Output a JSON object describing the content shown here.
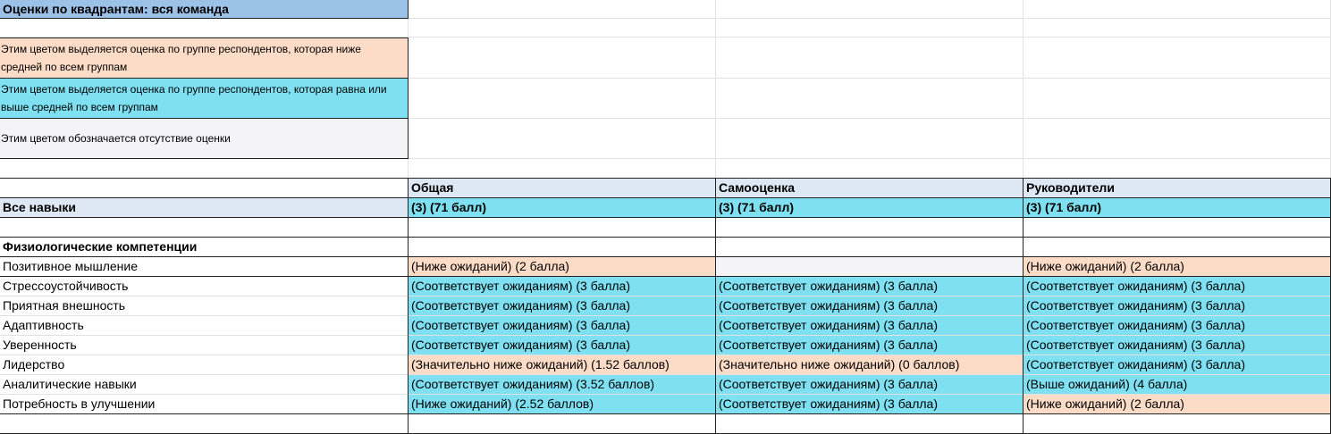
{
  "sheet": {
    "title": "Оценки по квадрантам: вся команда",
    "legend": [
      {
        "text": "Этим цветом выделяется оценка по группе респондентов, которая ниже средней по всем группам",
        "color": "#fcdcc6"
      },
      {
        "text": "Этим цветом выделяется оценка по группе респондентов, которая равна или выше средней по всем группам",
        "color": "#7fe0f2"
      },
      {
        "text": "Этим цветом обозначается отсутствие оценки",
        "color": "#f4f4f6"
      }
    ],
    "columns": [
      "Общая",
      "Самооценка",
      "Руководители"
    ],
    "summary": {
      "label": "Все навыки",
      "values": [
        "(3) (71 балл)",
        "(3) (71 балл)",
        "(3) (71 балл)"
      ]
    },
    "section_title": "Физиологические компетенции",
    "rows": [
      {
        "label": "Позитивное мышление",
        "cells": [
          {
            "text": "(Ниже ожиданий) (2 балла)",
            "color": "peach"
          },
          {
            "text": "",
            "color": "grey"
          },
          {
            "text": "(Ниже ожиданий) (2 балла)",
            "color": "peach"
          }
        ]
      },
      {
        "label": "Стрессоустойчивость",
        "cells": [
          {
            "text": "(Соответствует ожиданиям) (3 балла)",
            "color": "cyan"
          },
          {
            "text": "(Соответствует ожиданиям) (3 балла)",
            "color": "cyan"
          },
          {
            "text": "(Соответствует ожиданиям) (3 балла)",
            "color": "cyan"
          }
        ]
      },
      {
        "label": "Приятная внешность",
        "cells": [
          {
            "text": "(Соответствует ожиданиям) (3 балла)",
            "color": "cyan"
          },
          {
            "text": "(Соответствует ожиданиям) (3 балла)",
            "color": "cyan"
          },
          {
            "text": "(Соответствует ожиданиям) (3 балла)",
            "color": "cyan"
          }
        ]
      },
      {
        "label": "Адаптивность",
        "cells": [
          {
            "text": "(Соответствует ожиданиям) (3 балла)",
            "color": "cyan"
          },
          {
            "text": "(Соответствует ожиданиям) (3 балла)",
            "color": "cyan"
          },
          {
            "text": "(Соответствует ожиданиям) (3 балла)",
            "color": "cyan"
          }
        ]
      },
      {
        "label": "Уверенность",
        "cells": [
          {
            "text": "(Соответствует ожиданиям) (3 балла)",
            "color": "cyan"
          },
          {
            "text": "(Соответствует ожиданиям) (3 балла)",
            "color": "cyan"
          },
          {
            "text": "(Соответствует ожиданиям) (3 балла)",
            "color": "cyan"
          }
        ]
      },
      {
        "label": "Лидерство",
        "cells": [
          {
            "text": "(Значительно ниже ожиданий) (1.52 баллов)",
            "color": "peach"
          },
          {
            "text": "(Значительно ниже ожиданий) (0 баллов)",
            "color": "peach"
          },
          {
            "text": "(Соответствует ожиданиям) (3 балла)",
            "color": "cyan"
          }
        ]
      },
      {
        "label": "Аналитические навыки",
        "cells": [
          {
            "text": "(Соответствует ожиданиям) (3.52 баллов)",
            "color": "cyan"
          },
          {
            "text": "(Соответствует ожиданиям) (3 балла)",
            "color": "cyan"
          },
          {
            "text": "(Выше ожиданий) (4 балла)",
            "color": "cyan"
          }
        ]
      },
      {
        "label": "Потребность в улучшении",
        "cells": [
          {
            "text": "(Ниже ожиданий) (2.52 баллов)",
            "color": "cyan"
          },
          {
            "text": "(Соответствует ожиданиям) (3 балла)",
            "color": "cyan"
          },
          {
            "text": "(Ниже ожиданий) (2 балла)",
            "color": "peach"
          }
        ]
      }
    ]
  }
}
